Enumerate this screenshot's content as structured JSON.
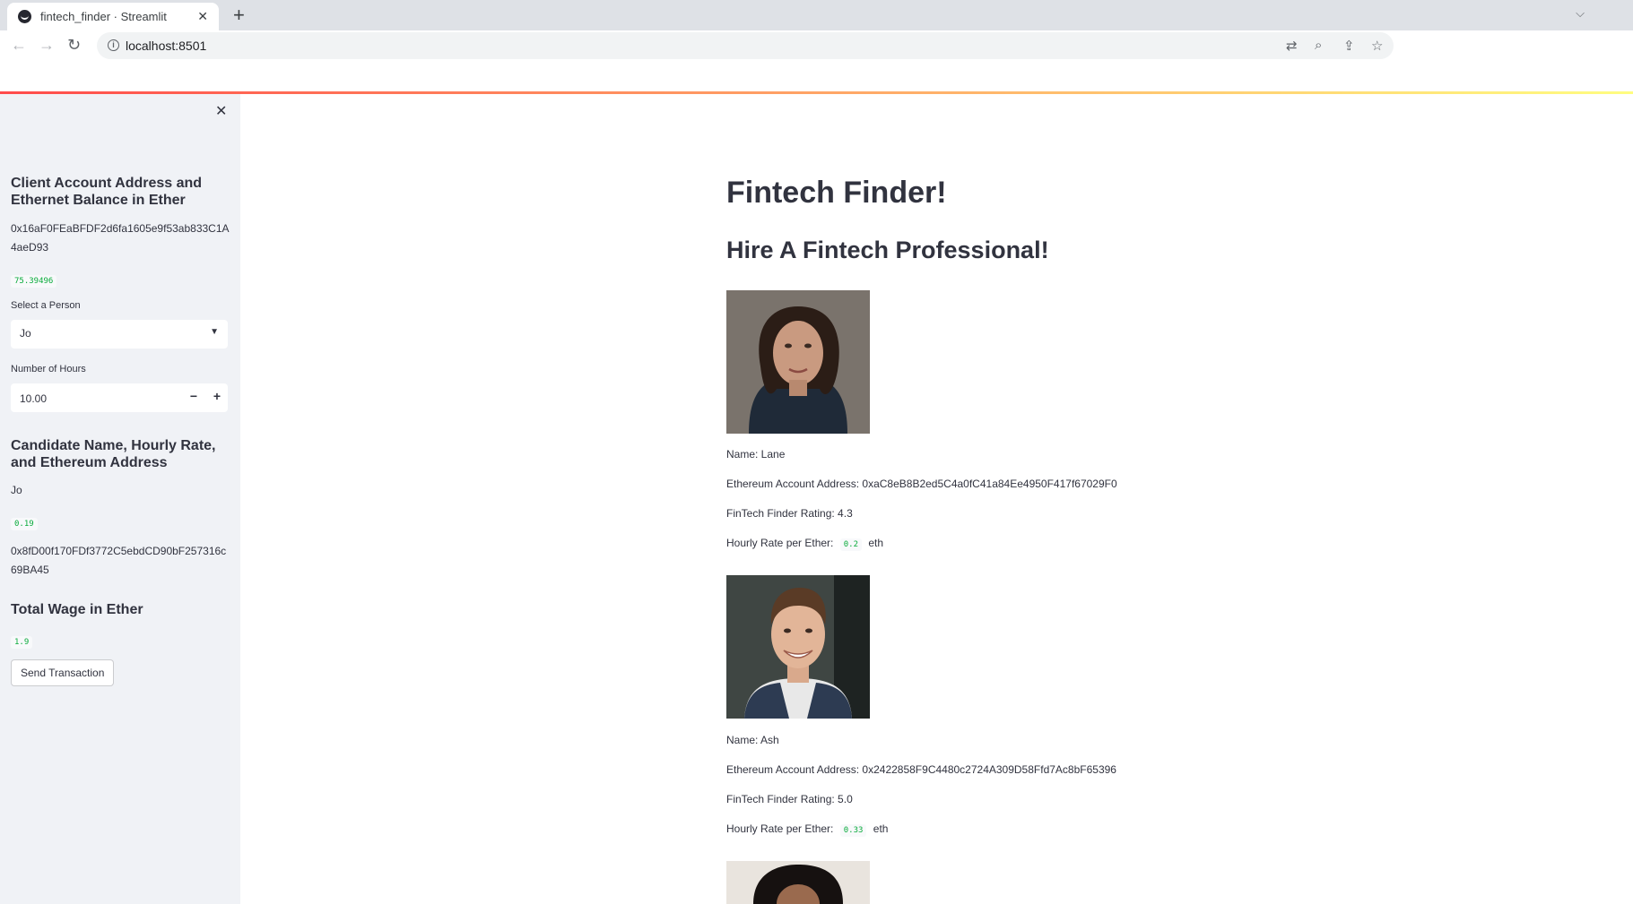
{
  "browser": {
    "tab_title": "fintech_finder · Streamlit",
    "url": "localhost:8501"
  },
  "sidebar": {
    "client_heading": "Client Account Address and Ethernet Balance in Ether",
    "client_address": "0x16aF0FEaBFDF2d6fa1605e9f53ab833C1A4aeD93",
    "client_balance": "75.39496",
    "select_label": "Select a Person",
    "select_value": "Jo",
    "hours_label": "Number of Hours",
    "hours_value": "10.00",
    "candidate_heading": "Candidate Name, Hourly Rate, and Ethereum Address",
    "candidate_name": "Jo",
    "candidate_rate": "0.19",
    "candidate_address": "0x8fD00f170FDf3772C5ebdCD90bF257316c69BA45",
    "wage_heading": "Total Wage in Ether",
    "wage_value": "1.9",
    "send_button": "Send Transaction"
  },
  "main": {
    "title": "Fintech Finder!",
    "subtitle": "Hire A Fintech Professional!",
    "candidates": [
      {
        "name": "Name: Lane",
        "address": "Ethereum Account Address: 0xaC8eB8B2ed5C4a0fC41a84Ee4950F417f67029F0",
        "rating": "FinTech Finder Rating: 4.3",
        "rate_label": "Hourly Rate per Ether:",
        "rate_value": "0.2",
        "rate_unit": "eth"
      },
      {
        "name": "Name: Ash",
        "address": "Ethereum Account Address: 0x2422858F9C4480c2724A309D58Ffd7Ac8bF65396",
        "rating": "FinTech Finder Rating: 5.0",
        "rate_label": "Hourly Rate per Ether:",
        "rate_value": "0.33",
        "rate_unit": "eth"
      }
    ]
  }
}
